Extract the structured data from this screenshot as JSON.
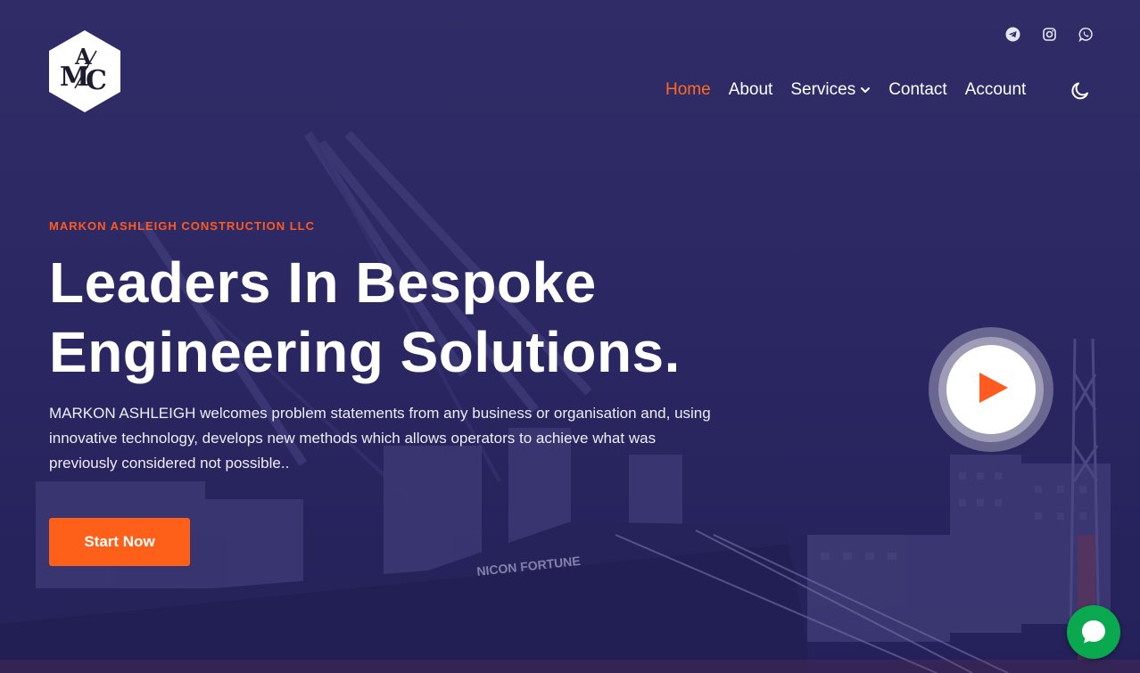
{
  "brand": {
    "logo_letters": [
      "A",
      "M",
      "C"
    ]
  },
  "social": [
    {
      "icon": "telegram-icon",
      "name": "Telegram"
    },
    {
      "icon": "instagram-icon",
      "name": "Instagram"
    },
    {
      "icon": "whatsapp-icon",
      "name": "WhatsApp"
    }
  ],
  "nav": {
    "items": [
      {
        "label": "Home",
        "active": true
      },
      {
        "label": "About",
        "active": false
      },
      {
        "label": "Services",
        "active": false,
        "has_dropdown": true
      },
      {
        "label": "Contact",
        "active": false
      },
      {
        "label": "Account",
        "active": false
      }
    ],
    "theme_icon": "moon-icon"
  },
  "hero": {
    "eyebrow": "MARKON ASHLEIGH CONSTRUCTION LLC",
    "headline_line1": "Leaders In Bespoke",
    "headline_line2": "Engineering Solutions.",
    "description": "MARKON ASHLEIGH welcomes problem statements from any business or organisation and, using innovative technology, develops new methods which allows operators to achieve what was previously considered not possible..",
    "cta_label": "Start Now",
    "ship_name": "NICON FORTUNE",
    "play_icon": "play-icon"
  },
  "chat": {
    "icon": "chat-icon"
  },
  "colors": {
    "accent": "#ff6019",
    "background": "#2b2860",
    "chat": "#0aa84f",
    "text": "#ffffff"
  }
}
